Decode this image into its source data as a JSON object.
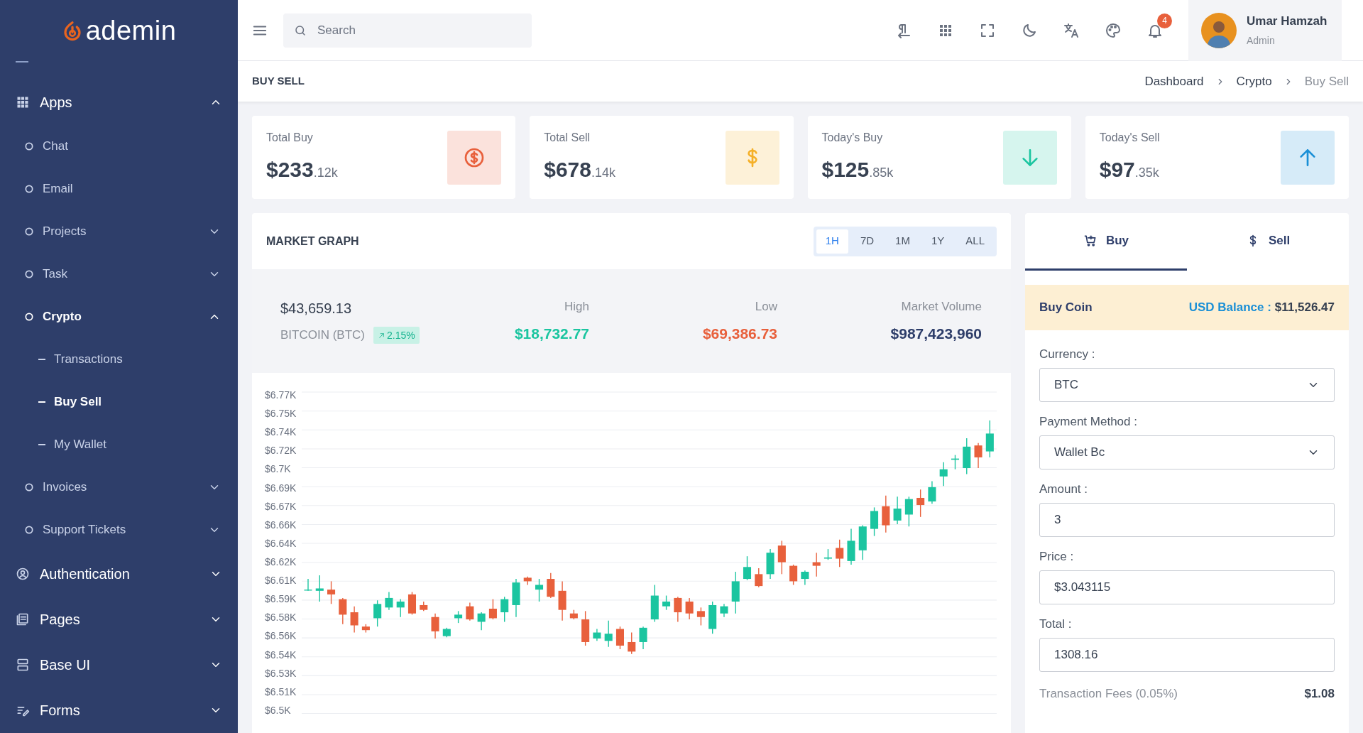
{
  "sidebar": {
    "logo": "ademin",
    "nav": [
      {
        "label": "Apps",
        "expanded": true,
        "children": [
          {
            "label": "Chat"
          },
          {
            "label": "Email"
          },
          {
            "label": "Projects",
            "expanded": false
          },
          {
            "label": "Task",
            "expanded": false
          },
          {
            "label": "Crypto",
            "expanded": true,
            "children": [
              {
                "label": "Transactions",
                "selected": false
              },
              {
                "label": "Buy Sell",
                "selected": true
              },
              {
                "label": "My Wallet",
                "selected": false
              }
            ]
          },
          {
            "label": "Invoices",
            "expanded": false
          },
          {
            "label": "Support Tickets",
            "expanded": false
          }
        ]
      },
      {
        "label": "Authentication",
        "expanded": false
      },
      {
        "label": "Pages",
        "expanded": false
      },
      {
        "label": "Base UI",
        "expanded": false
      },
      {
        "label": "Forms",
        "expanded": false
      }
    ]
  },
  "header": {
    "search": {
      "placeholder": "Search"
    },
    "notifications": "4",
    "user": {
      "name": "Umar Hamzah",
      "role": "Admin"
    }
  },
  "page": {
    "title": "BUY SELL",
    "breadcrumb": [
      "Dashboard",
      "Crypto",
      "Buy Sell"
    ]
  },
  "stats": [
    {
      "label": "Total Buy",
      "value": "$233",
      "suffix": ".12k",
      "color": "#e8603c"
    },
    {
      "label": "Total Sell",
      "value": "$678",
      "suffix": ".14k",
      "color": "#f5b027"
    },
    {
      "label": "Today's Buy",
      "value": "$125",
      "suffix": ".85k",
      "color": "#1bc5a0"
    },
    {
      "label": "Today's Sell",
      "value": "$97",
      "suffix": ".35k",
      "color": "#1a8fd6"
    }
  ],
  "market": {
    "title": "MARKET GRAPH",
    "ranges": [
      {
        "label": "1H",
        "selected": true
      },
      {
        "label": "7D",
        "selected": false
      },
      {
        "label": "1M",
        "selected": false
      },
      {
        "label": "1Y",
        "selected": false
      },
      {
        "label": "ALL",
        "selected": false
      }
    ],
    "price": "$43,659.13",
    "coin": "BITCOIN (BTC)",
    "change": "2.15%",
    "figures": [
      {
        "label": "High",
        "value": "$18,732.77",
        "color": "#1bc5a0"
      },
      {
        "label": "Low",
        "value": "$69,386.73",
        "color": "#e8603c"
      },
      {
        "label": "Market Volume",
        "value": "$987,423,960",
        "color": "#2e3e6a"
      }
    ],
    "chart_data": {
      "type": "candlestick",
      "grid": true,
      "ylim": [
        6497,
        6766.79
      ],
      "yticks": [
        {
          "value": 6766.79,
          "label": "$6.77K"
        },
        {
          "value": 6750.92,
          "label": "$6.75K"
        },
        {
          "value": 6735.05,
          "label": "$6.74K"
        },
        {
          "value": 6719.18,
          "label": "$6.72K"
        },
        {
          "value": 6703.31,
          "label": "$6.7K"
        },
        {
          "value": 6687.44,
          "label": "$6.69K"
        },
        {
          "value": 6671.57,
          "label": "$6.67K"
        },
        {
          "value": 6655.7,
          "label": "$6.66K"
        },
        {
          "value": 6639.83,
          "label": "$6.64K"
        },
        {
          "value": 6623.96,
          "label": "$6.62K"
        },
        {
          "value": 6608.09,
          "label": "$6.61K"
        },
        {
          "value": 6592.22,
          "label": "$6.59K"
        },
        {
          "value": 6576.35,
          "label": "$6.58K"
        },
        {
          "value": 6560.48,
          "label": "$6.56K"
        },
        {
          "value": 6544.61,
          "label": "$6.54K"
        },
        {
          "value": 6528.74,
          "label": "$6.53K"
        },
        {
          "value": 6512.87,
          "label": "$6.51K"
        },
        {
          "value": 6497,
          "label": "$6.5K"
        }
      ],
      "ohlc": [
        [
          6601,
          6610,
          6600,
          6601
        ],
        [
          6600,
          6613,
          6591,
          6602
        ],
        [
          6601,
          6608,
          6589,
          6597
        ],
        [
          6593,
          6594,
          6572,
          6580
        ],
        [
          6582,
          6587,
          6565,
          6571
        ],
        [
          6570,
          6572,
          6565,
          6567
        ],
        [
          6577,
          6592,
          6570,
          6589
        ],
        [
          6586,
          6599,
          6584,
          6594
        ],
        [
          6586,
          6593,
          6578,
          6591
        ],
        [
          6597,
          6599,
          6580,
          6581
        ],
        [
          6588,
          6591,
          6583,
          6584
        ],
        [
          6578,
          6581,
          6560,
          6566
        ],
        [
          6562,
          6569,
          6561,
          6568
        ],
        [
          6577,
          6583,
          6573,
          6580
        ],
        [
          6587,
          6590,
          6575,
          6576
        ],
        [
          6574,
          6582,
          6567,
          6581
        ],
        [
          6585,
          6593,
          6576,
          6577
        ],
        [
          6582,
          6595,
          6574,
          6593
        ],
        [
          6588,
          6610,
          6578,
          6607
        ],
        [
          6611,
          6612,
          6605,
          6608
        ],
        [
          6601,
          6610,
          6591,
          6605
        ],
        [
          6610,
          6615,
          6594,
          6595
        ],
        [
          6600,
          6608,
          6575,
          6584
        ],
        [
          6581,
          6584,
          6576,
          6577
        ],
        [
          6576,
          6583,
          6554,
          6557
        ],
        [
          6560,
          6568,
          6558,
          6565
        ],
        [
          6558,
          6575,
          6553,
          6564
        ],
        [
          6568,
          6570,
          6551,
          6554
        ],
        [
          6557,
          6565,
          6547,
          6549
        ],
        [
          6557,
          6570,
          6551,
          6569
        ],
        [
          6576,
          6605,
          6574,
          6596
        ],
        [
          6587,
          6596,
          6584,
          6591
        ],
        [
          6594,
          6595,
          6574,
          6582
        ],
        [
          6591,
          6594,
          6576,
          6581
        ],
        [
          6583,
          6586,
          6571,
          6578
        ],
        [
          6568,
          6591,
          6564,
          6588
        ],
        [
          6581,
          6589,
          6578,
          6587
        ],
        [
          6591,
          6616,
          6581,
          6608
        ],
        [
          6610,
          6629,
          6609,
          6620
        ],
        [
          6614,
          6619,
          6603,
          6604
        ],
        [
          6614,
          6635,
          6610,
          6632
        ],
        [
          6638,
          6642,
          6614,
          6624
        ],
        [
          6621,
          6622,
          6605,
          6608
        ],
        [
          6610,
          6617,
          6605,
          6616
        ],
        [
          6624,
          6632,
          6612,
          6621
        ],
        [
          6627,
          6635,
          6626,
          6628
        ],
        [
          6636,
          6643,
          6620,
          6627
        ],
        [
          6625,
          6652,
          6622,
          6642
        ],
        [
          6634,
          6655,
          6626,
          6654
        ],
        [
          6652,
          6670,
          6646,
          6667
        ],
        [
          6671,
          6680,
          6649,
          6655
        ],
        [
          6659,
          6679,
          6656,
          6669
        ],
        [
          6664,
          6679,
          6654,
          6677
        ],
        [
          6678,
          6685,
          6662,
          6672
        ],
        [
          6675,
          6692,
          6673,
          6687
        ],
        [
          6696,
          6708,
          6688,
          6702
        ],
        [
          6710,
          6714,
          6702,
          6711
        ],
        [
          6703,
          6728,
          6698,
          6721
        ],
        [
          6722,
          6724,
          6703,
          6712
        ],
        [
          6717,
          6743,
          6712,
          6732
        ]
      ]
    }
  },
  "trade": {
    "tabs": [
      {
        "label": "Buy",
        "selected": true
      },
      {
        "label": "Sell",
        "selected": false
      }
    ],
    "heading": "Buy Coin",
    "balance_label": "USD Balance :",
    "balance": "$11,526.47",
    "fields": [
      {
        "label": "Currency :",
        "kind": "select",
        "value": "BTC"
      },
      {
        "label": "Payment Method :",
        "kind": "select",
        "value": "Wallet Bc"
      },
      {
        "label": "Amount :",
        "kind": "input",
        "value": "3"
      },
      {
        "label": "Price :",
        "kind": "input",
        "value": "$3.043115"
      },
      {
        "label": "Total :",
        "kind": "input",
        "value": "1308.16"
      }
    ],
    "fees_label": "Transaction Fees (0.05%)",
    "fees": "$1.08"
  }
}
